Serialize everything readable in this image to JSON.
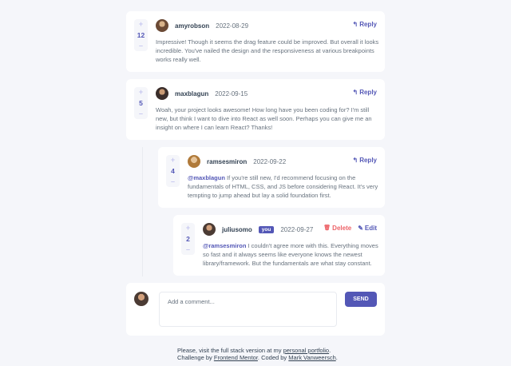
{
  "comments": [
    {
      "author": "amyrobson",
      "date": "2022-08-29",
      "score": "12",
      "reply_label": "Reply",
      "text": "Impressive! Though it seems the drag feature could be improved. But overall it looks incredible. You've nailed the design and the responsiveness at various breakpoints works really well."
    },
    {
      "author": "maxblagun",
      "date": "2022-09-15",
      "score": "5",
      "reply_label": "Reply",
      "text": "Woah, your project looks awesome! How long have you been coding for? I'm still new, but think I want to dive into React as well soon. Perhaps you can give me an insight on where I can learn React? Thanks!"
    }
  ],
  "replies": [
    {
      "author": "ramsesmiron",
      "date": "2022-09-22",
      "score": "4",
      "reply_label": "Reply",
      "mention": "@maxblagun",
      "text": "If you're still new, I'd recommend focusing on the fundamentals of HTML, CSS, and JS before considering React. It's very tempting to jump ahead but lay a solid foundation first."
    },
    {
      "author": "juliusomo",
      "you_badge": "you",
      "date": "2022-09-27",
      "score": "2",
      "delete_label": "Delete",
      "edit_label": "Edit",
      "mention": "@ramsesmiron",
      "text": "I couldn't agree more with this. Everything moves so fast and it always seems like everyone knows the newest library/framework. But the fundamentals are what stay constant."
    }
  ],
  "composer": {
    "placeholder": "Add a comment...",
    "send_label": "SEND"
  },
  "footer": {
    "line1_prefix": "Please, visit the full stack version at my",
    "line1_link": "personal portfolio",
    "line1_suffix": ".",
    "line2_prefix": "Challenge by",
    "line2_link1": "Frontend Mentor",
    "line2_mid": ". Coded by",
    "line2_link2": "Mark Vanweersch",
    "line2_suffix": "."
  },
  "icons": {
    "plus": "+",
    "minus": "–",
    "reply": "↰",
    "delete": "🗑",
    "edit": "✎"
  },
  "colors": {
    "accent": "#5357b6",
    "danger": "#ed6368",
    "text": "#67727e",
    "heading": "#334253",
    "background": "#f5f6fa"
  }
}
